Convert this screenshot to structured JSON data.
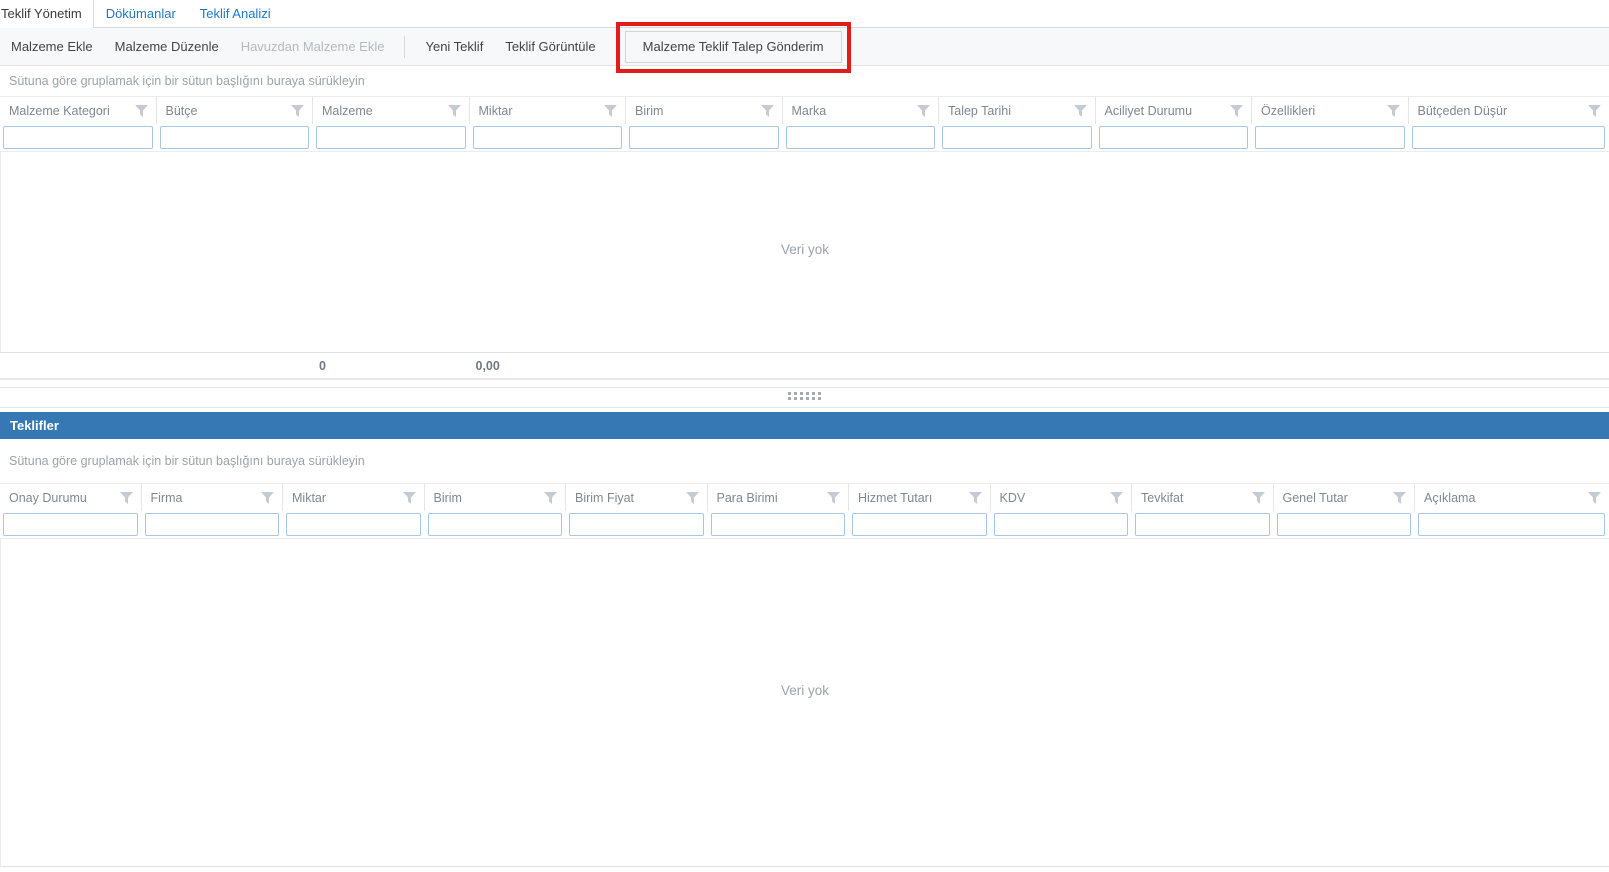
{
  "colors": {
    "accent_blue": "#3678b4",
    "link_blue": "#1f78c1",
    "annotation_red": "#e11c1c"
  },
  "tabs": {
    "items": [
      {
        "label": "Teklif Yönetim",
        "active": true
      },
      {
        "label": "Dökümanlar",
        "active": false
      },
      {
        "label": "Teklif Analizi",
        "active": false
      }
    ]
  },
  "toolbar": {
    "buttons": [
      {
        "label": "Malzeme Ekle"
      },
      {
        "label": "Malzeme Düzenle"
      },
      {
        "label": "Havuzdan Malzeme Ekle",
        "disabled": true
      },
      {
        "label": "Yeni Teklif"
      },
      {
        "label": "Teklif Görüntüle"
      },
      {
        "label": "Malzeme Teklif Talep Gönderim",
        "highlighted": true
      }
    ]
  },
  "materials_grid": {
    "group_panel_text": "Sütuna göre gruplamak için bir sütun başlığını buraya sürükleyin",
    "empty_text": "Veri yok",
    "columns": [
      {
        "label": "Malzeme Kategori"
      },
      {
        "label": "Bütçe"
      },
      {
        "label": "Malzeme",
        "summary": "0"
      },
      {
        "label": "Miktar",
        "summary": "0,00"
      },
      {
        "label": "Birim"
      },
      {
        "label": "Marka"
      },
      {
        "label": "Talep Tarihi"
      },
      {
        "label": "Aciliyet Durumu"
      },
      {
        "label": "Özellikleri"
      },
      {
        "label": "Bütçeden Düşür"
      }
    ]
  },
  "offers_panel": {
    "title": "Teklifler"
  },
  "offers_grid": {
    "group_panel_text": "Sütuna göre gruplamak için bir sütun başlığını buraya sürükleyin",
    "empty_text": "Veri yok",
    "columns": [
      {
        "label": "Onay Durumu"
      },
      {
        "label": "Firma"
      },
      {
        "label": "Miktar"
      },
      {
        "label": "Birim"
      },
      {
        "label": "Birim Fiyat"
      },
      {
        "label": "Para Birimi"
      },
      {
        "label": "Hizmet Tutarı"
      },
      {
        "label": "KDV"
      },
      {
        "label": "Tevkifat"
      },
      {
        "label": "Genel Tutar"
      },
      {
        "label": "Açıklama"
      }
    ]
  }
}
